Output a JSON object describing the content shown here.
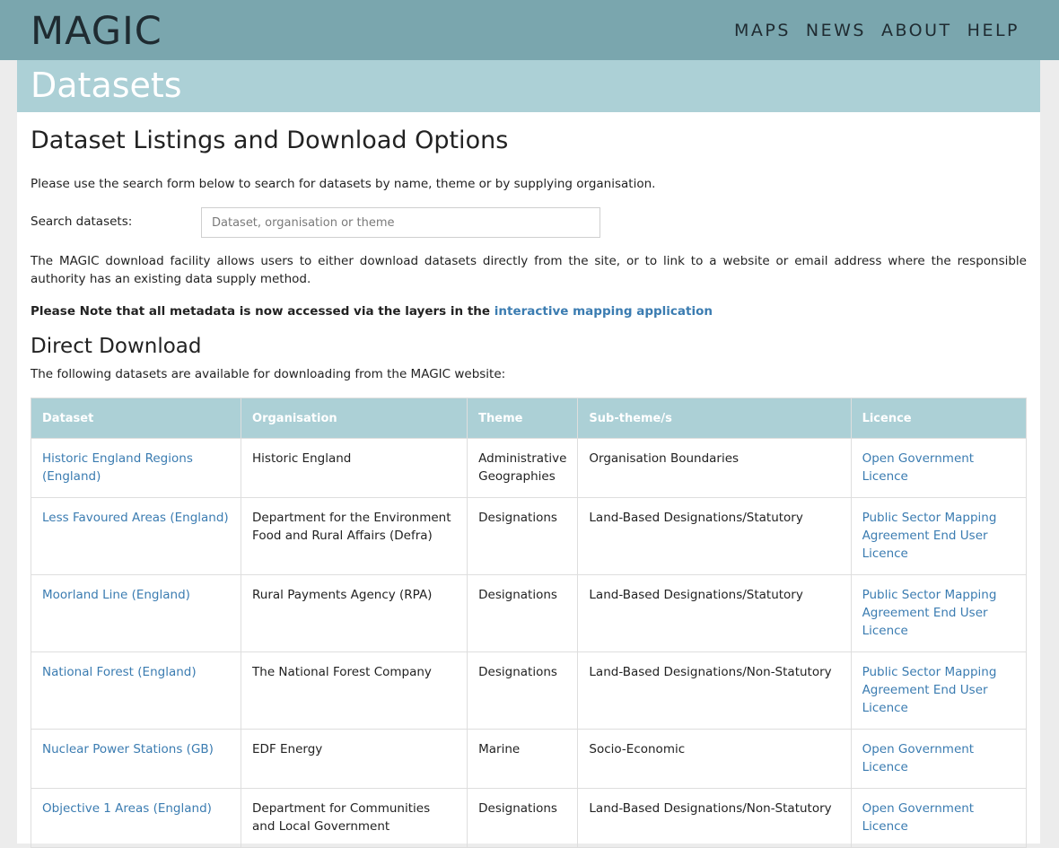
{
  "header": {
    "logo": "MAGIC",
    "nav": [
      "MAPS",
      "NEWS",
      "ABOUT",
      "HELP"
    ]
  },
  "banner": {
    "title": "Datasets"
  },
  "page": {
    "title": "Dataset Listings and Download Options",
    "intro": "Please use the search form below to search for datasets by name, theme or by supplying organisation.",
    "search_label": "Search datasets:",
    "search_placeholder": "Dataset, organisation or theme",
    "description": "The MAGIC download facility allows users to either download datasets directly from the site, or to link to a website or email address where the responsible authority has an existing data supply method.",
    "note_text": "Please Note that all metadata is now accessed via the layers in the",
    "note_link": "interactive mapping application",
    "section_title": "Direct Download",
    "section_desc": "The following datasets are available for downloading from the MAGIC website:"
  },
  "table": {
    "headers": [
      "Dataset",
      "Organisation",
      "Theme",
      "Sub-theme/s",
      "Licence"
    ],
    "rows": [
      [
        "Historic England Regions (England)",
        "Historic England",
        "Administrative Geographies",
        "Organisation Boundaries",
        "Open Government Licence"
      ],
      [
        "Less Favoured Areas (England)",
        "Department for the Environment Food and Rural Affairs (Defra)",
        "Designations",
        "Land-Based Designations/Statutory",
        "Public Sector Mapping Agreement End User Licence"
      ],
      [
        "Moorland Line (England)",
        "Rural Payments Agency (RPA)",
        "Designations",
        "Land-Based Designations/Statutory",
        "Public Sector Mapping Agreement End User Licence"
      ],
      [
        "National Forest (England)",
        "The National Forest Company",
        "Designations",
        "Land-Based Designations/Non-Statutory",
        "Public Sector Mapping Agreement End User Licence"
      ],
      [
        "Nuclear Power Stations (GB)",
        "EDF Energy",
        "Marine",
        "Socio-Economic",
        "Open Government Licence"
      ],
      [
        "Objective 1 Areas (England)",
        "Department for Communities and Local Government",
        "Designations",
        "Land-Based Designations/Non-Statutory",
        "Open Government Licence"
      ]
    ]
  }
}
